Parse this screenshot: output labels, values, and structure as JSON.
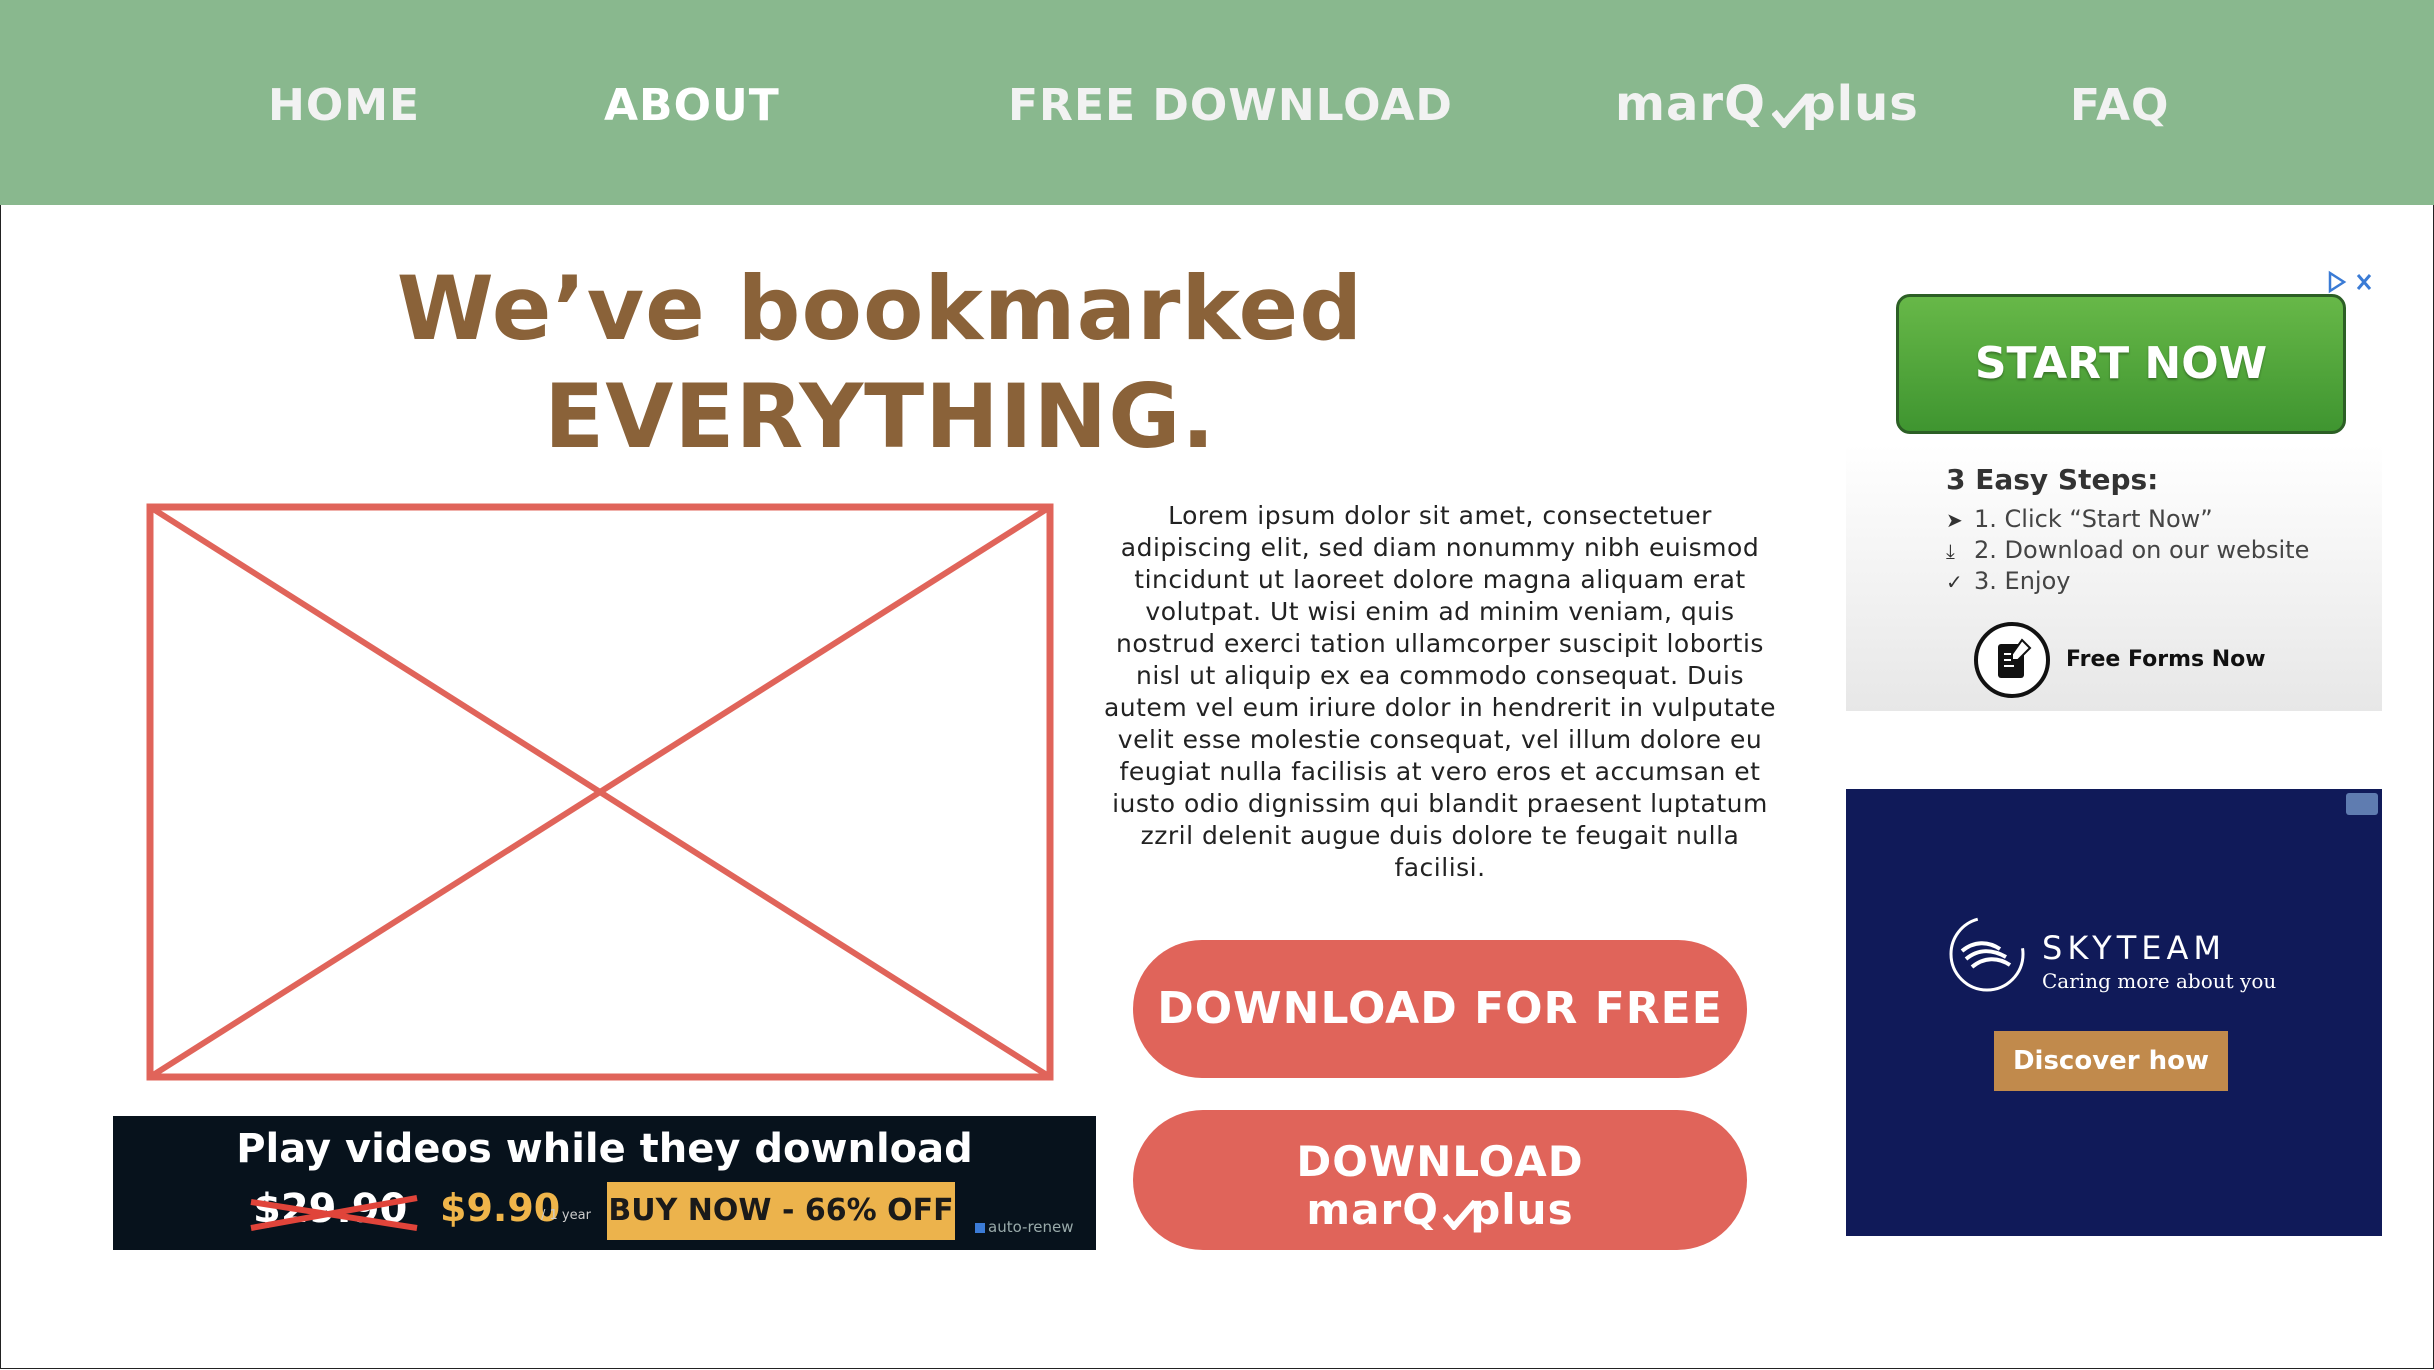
{
  "nav": {
    "home": "HOME",
    "about": "ABOUT",
    "free_download": "FREE DOWNLOAD",
    "brand_left": "marQ",
    "brand_right": "plus",
    "faq": "FAQ"
  },
  "hero": {
    "line1": "We’ve bookmarked",
    "line2": "EVERYTHING."
  },
  "body_text": "Lorem ipsum dolor sit amet, consectetuer adipiscing elit, sed diam nonummy nibh euismod tincidunt ut laoreet dolore magna aliquam erat volutpat. Ut wisi enim ad minim veniam, quis nostrud exerci tation ullamcorper suscipit lobortis nisl ut aliquip ex ea commodo consequat. Duis autem vel eum iriure dolor in hendrerit in vulputate velit esse molestie consequat, vel illum dolore eu feugiat nulla facilisis at vero eros et accumsan et iusto odio dignissim qui blandit praesent luptatum zzril delenit augue duis dolore te feugait nulla facilisi.",
  "buttons": {
    "free_label": "DOWNLOAD FOR FREE",
    "plus_line1": "DOWNLOAD",
    "plus_brand_left": "marQ",
    "plus_brand_right": "plus"
  },
  "banner_ad": {
    "title": "Play videos while they download",
    "old_price": "$29.90",
    "price": "$9.90",
    "period": "/ 1 year",
    "buy": "BUY NOW - 66% OFF",
    "renew": "auto-renew"
  },
  "ad1": {
    "button": "START NOW",
    "steps_title": "3 Easy Steps:",
    "steps": [
      "1. Click “Start Now”",
      "2. Download on our website",
      "3. Enjoy"
    ],
    "footer": "Free Forms Now"
  },
  "ad2": {
    "name": "SKYTEAM",
    "tagline": "Caring more about you",
    "cta": "Discover how"
  },
  "colors": {
    "nav_bg": "#89b88e",
    "heading": "#8a6239",
    "accent": "#e0645a",
    "banner_bg": "#07121c",
    "skyteam_bg": "#101a59"
  }
}
